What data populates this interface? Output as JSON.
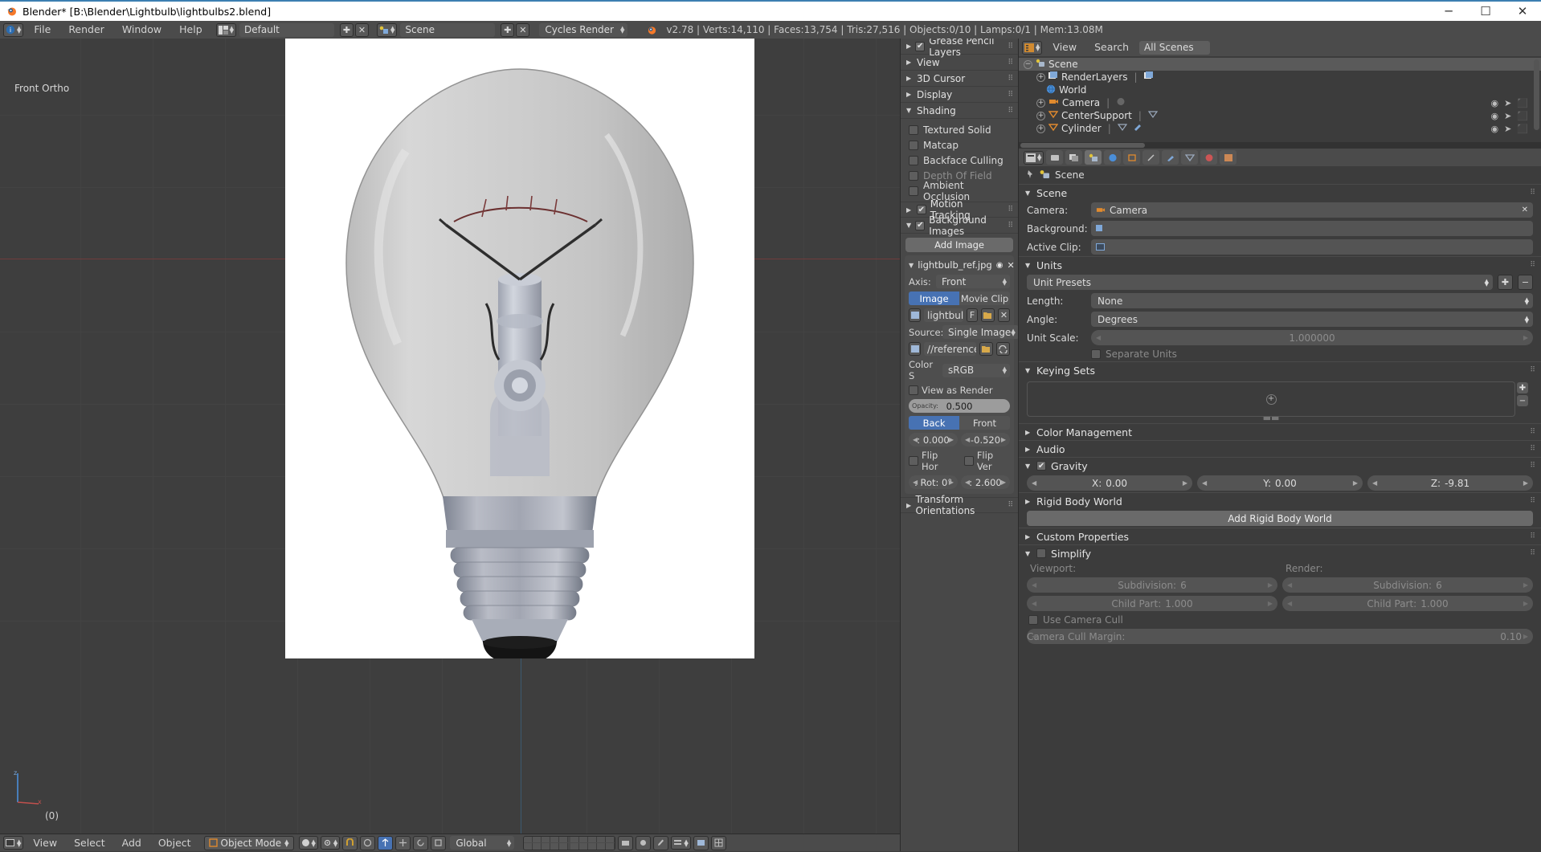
{
  "window": {
    "title": "Blender* [B:\\Blender\\Lightbulb\\lightbulbs2.blend]",
    "minimize": "─",
    "maximize": "☐",
    "close": "✕"
  },
  "topbar": {
    "menus": [
      "File",
      "Render",
      "Window",
      "Help"
    ],
    "screen_layout": "Default",
    "scene_name": "Scene",
    "render_engine": "Cycles Render",
    "stats": "v2.78 | Verts:14,110 | Faces:13,754 | Tris:27,516 | Objects:0/10 | Lamps:0/1 | Mem:13.08M",
    "add_icon": "✚",
    "unlink_icon": "✕"
  },
  "viewport": {
    "view_label": "Front Ortho",
    "frame_label": "(0)",
    "background_color": "#3e3e3e"
  },
  "npanel": {
    "rows": [
      {
        "label": "Grease Pencil Layers",
        "arrow": "▶",
        "checkbox": true
      },
      {
        "label": "View",
        "arrow": "▶",
        "checkbox": false
      },
      {
        "label": "3D Cursor",
        "arrow": "▶",
        "checkbox": false
      },
      {
        "label": "Display",
        "arrow": "▶",
        "checkbox": false
      },
      {
        "label": "Shading",
        "arrow": "▼",
        "checkbox": false
      }
    ],
    "shading_items": [
      {
        "label": "Textured Solid",
        "checked": false,
        "dim": false
      },
      {
        "label": "Matcap",
        "checked": false,
        "dim": false
      },
      {
        "label": "Backface Culling",
        "checked": false,
        "dim": false
      },
      {
        "label": "Depth Of Field",
        "checked": false,
        "dim": true
      },
      {
        "label": "Ambient Occlusion",
        "checked": false,
        "dim": false
      }
    ],
    "motion_tracking": {
      "label": "Motion Tracking",
      "arrow": "▶",
      "checked": true
    },
    "background_images": {
      "label": "Background Images",
      "arrow": "▼",
      "checked": true
    },
    "add_image_button": "Add Image",
    "image_entry": {
      "name": "lightbulb_ref.jpg",
      "eye_icon": "◉",
      "close_icon": "✕",
      "axis_label": "Axis:",
      "axis_value": "Front",
      "source_type_tabs": [
        "Image",
        "Movie Clip"
      ],
      "source_type_active": "Image",
      "datablock_name": "lightbulb_r",
      "fake_user": "F",
      "source_label": "Source:",
      "source_value": "Single Image",
      "filepath": "//reference_im...",
      "colorspace_label": "Color S",
      "colorspace_value": "sRGB",
      "view_as_render": "View as Render",
      "opacity_label": "Opacity:",
      "opacity_value": "0.500",
      "depth_tabs": [
        "Back",
        "Front"
      ],
      "depth_active": "Front",
      "offset_x": ": 0.000",
      "offset_y": "-0.520",
      "flip_hor": "Flip Hor",
      "flip_ver": "Flip Ver",
      "rotation": ": Rot: 0°",
      "size": ": 2.600"
    },
    "transform_orientations": {
      "label": "Transform Orientations",
      "arrow": "▶"
    }
  },
  "outliner": {
    "menus": [
      "View",
      "Search"
    ],
    "display_mode": "All Scenes",
    "tree": [
      {
        "label": "Scene",
        "indent": 0,
        "expander": "−",
        "icon": "🎬",
        "selected": true,
        "icons": []
      },
      {
        "label": "RenderLayers",
        "indent": 1,
        "expander": "+",
        "icon": "▣",
        "selected": false,
        "icons": []
      },
      {
        "label": "World",
        "indent": 1,
        "expander": "",
        "icon": "🌍",
        "selected": false,
        "icons": []
      },
      {
        "label": "Camera",
        "indent": 1,
        "expander": "+",
        "icon": "📷",
        "selected": false,
        "icons": [
          "◉",
          "➤",
          "⬛"
        ]
      },
      {
        "label": "CenterSupport",
        "indent": 1,
        "expander": "+",
        "icon": "▽",
        "selected": false,
        "icons": [
          "◉",
          "➤",
          "⬛"
        ]
      },
      {
        "label": "Cylinder",
        "indent": 1,
        "expander": "+",
        "icon": "▽",
        "selected": false,
        "icons": [
          "◉",
          "➤",
          "⬛"
        ]
      }
    ]
  },
  "properties": {
    "breadcrumb": "Scene",
    "sections": {
      "scene": {
        "label": "Scene",
        "arrow": "▼",
        "camera_label": "Camera:",
        "camera_value": "Camera",
        "background_label": "Background:",
        "background_value": "",
        "active_clip_label": "Active Clip:",
        "active_clip_value": ""
      },
      "units": {
        "label": "Units",
        "arrow": "▼",
        "presets_value": "Unit Presets",
        "length_label": "Length:",
        "length_value": "None",
        "angle_label": "Angle:",
        "angle_value": "Degrees",
        "unit_scale_label": "Unit Scale:",
        "unit_scale_value": "1.000000",
        "separate_units": "Separate Units"
      },
      "keying_sets": {
        "label": "Keying Sets",
        "arrow": "▼"
      },
      "color_management": {
        "label": "Color Management",
        "arrow": "▶"
      },
      "audio": {
        "label": "Audio",
        "arrow": "▶"
      },
      "gravity": {
        "label": "Gravity",
        "arrow": "▼",
        "checked": true,
        "x_label": "X:",
        "x_value": "0.00",
        "y_label": "Y:",
        "y_value": "0.00",
        "z_label": "Z:",
        "z_value": "-9.81"
      },
      "rigid_body_world": {
        "label": "Rigid Body World",
        "arrow": "▶",
        "add_button": "Add Rigid Body World"
      },
      "custom_properties": {
        "label": "Custom Properties",
        "arrow": "▶"
      },
      "simplify": {
        "label": "Simplify",
        "arrow": "▼",
        "checked": false,
        "viewport_label": "Viewport:",
        "render_label": "Render:",
        "subdivision_label": "Subdivision:",
        "subdivision_viewport": "6",
        "subdivision_render": "6",
        "child_part_label": "Child Part:",
        "child_part_viewport": "1.000",
        "child_part_render": "1.000",
        "use_camera_cull": "Use Camera Cull",
        "camera_cull_margin_label": "Camera Cull Margin:",
        "camera_cull_margin_value": "0.10"
      }
    }
  },
  "bottombar": {
    "menus": [
      "View",
      "Select",
      "Add",
      "Object"
    ],
    "mode": "Object Mode",
    "transform_orientation": "Global"
  },
  "colors": {
    "accent_blue": "#4772b3",
    "title_border": "#3c7fb1",
    "header_gray": "#4b4b4b",
    "panel_gray": "#484848"
  }
}
